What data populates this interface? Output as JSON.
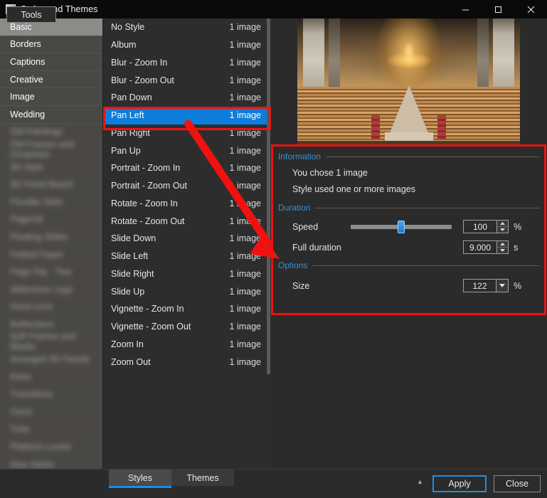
{
  "window": {
    "title": "Styles and Themes",
    "icon": "app-icon",
    "controls": {
      "minimize": "minimize-icon",
      "maximize": "maximize-icon",
      "close": "close-icon"
    }
  },
  "sidebar": {
    "items": [
      {
        "label": "Basic",
        "active": true,
        "blurred": false
      },
      {
        "label": "Borders",
        "active": false,
        "blurred": false
      },
      {
        "label": "Captions",
        "active": false,
        "blurred": false
      },
      {
        "label": "Creative",
        "active": false,
        "blurred": false
      },
      {
        "label": "Image",
        "active": false,
        "blurred": false
      },
      {
        "label": "Wedding",
        "active": false,
        "blurred": false
      },
      {
        "label": "Old Paintings",
        "active": false,
        "blurred": true
      },
      {
        "label": "Old Frames and Ornament",
        "active": false,
        "blurred": true
      },
      {
        "label": "3D Style",
        "active": false,
        "blurred": true
      },
      {
        "label": "3D Panel Board",
        "active": false,
        "blurred": true
      },
      {
        "label": "Flexible Slide",
        "active": false,
        "blurred": true
      },
      {
        "label": "Pageroll",
        "active": false,
        "blurred": true
      },
      {
        "label": "Floating Slides",
        "active": false,
        "blurred": true
      },
      {
        "label": "Folded Paper",
        "active": false,
        "blurred": true
      },
      {
        "label": "Page Flip - Two",
        "active": false,
        "blurred": true
      },
      {
        "label": "Slideshow Logo",
        "active": false,
        "blurred": true
      },
      {
        "label": "Hand Lens",
        "active": false,
        "blurred": true
      },
      {
        "label": "Reflections",
        "active": false,
        "blurred": true
      },
      {
        "label": "Soft Frames and Masks",
        "active": false,
        "blurred": true
      },
      {
        "label": "Arranged 3D Panels",
        "active": false,
        "blurred": true
      },
      {
        "label": "Rotor",
        "active": false,
        "blurred": true
      },
      {
        "label": "Transitions",
        "active": false,
        "blurred": true
      },
      {
        "label": "Clock",
        "active": false,
        "blurred": true
      },
      {
        "label": "Tube",
        "active": false,
        "blurred": true
      },
      {
        "label": "Platform Levels",
        "active": false,
        "blurred": true
      },
      {
        "label": "New Styles",
        "active": false,
        "blurred": true
      }
    ]
  },
  "styles_list": {
    "count_label": "1 image",
    "selected": "Pan Left",
    "items": [
      {
        "name": "No Style",
        "count": "1 image"
      },
      {
        "name": "Album",
        "count": "1 image"
      },
      {
        "name": "Blur - Zoom In",
        "count": "1 image"
      },
      {
        "name": "Blur - Zoom Out",
        "count": "1 image"
      },
      {
        "name": "Pan Down",
        "count": "1 image"
      },
      {
        "name": "Pan Left",
        "count": "1 image"
      },
      {
        "name": "Pan Right",
        "count": "1 image"
      },
      {
        "name": "Pan Up",
        "count": "1 image"
      },
      {
        "name": "Portrait - Zoom In",
        "count": "1 image"
      },
      {
        "name": "Portrait - Zoom Out",
        "count": "1 image"
      },
      {
        "name": "Rotate - Zoom In",
        "count": "1 image"
      },
      {
        "name": "Rotate - Zoom Out",
        "count": "1 image"
      },
      {
        "name": "Slide Down",
        "count": "1 image"
      },
      {
        "name": "Slide Left",
        "count": "1 image"
      },
      {
        "name": "Slide Right",
        "count": "1 image"
      },
      {
        "name": "Slide Up",
        "count": "1 image"
      },
      {
        "name": "Vignette - Zoom In",
        "count": "1 image"
      },
      {
        "name": "Vignette - Zoom Out",
        "count": "1 image"
      },
      {
        "name": "Zoom In",
        "count": "1 image"
      },
      {
        "name": "Zoom Out",
        "count": "1 image"
      }
    ]
  },
  "preview": {
    "alt": "cathedral-interior-preview"
  },
  "panel": {
    "information": {
      "title": "Information",
      "lines": [
        "You chose 1 image",
        "Style used one or more images"
      ]
    },
    "duration": {
      "title": "Duration",
      "speed_label": "Speed",
      "speed_value": "100",
      "speed_unit": "%",
      "speed_slider_percent": 50,
      "full_duration_label": "Full duration",
      "full_duration_value": "9.000",
      "full_duration_unit": "s"
    },
    "options": {
      "title": "Options",
      "size_label": "Size",
      "size_value": "122",
      "size_unit": "%"
    }
  },
  "bottom": {
    "tools_label": "Tools",
    "tabs": [
      {
        "label": "Styles",
        "active": true
      },
      {
        "label": "Themes",
        "active": false
      }
    ],
    "collapse_icon": "chevron-up-icon",
    "apply_label": "Apply",
    "close_label": "Close"
  },
  "annotations": {
    "accent_color": "#f11111",
    "selection_color": "#0d7ddb",
    "section_title_color": "#3c8fd4"
  }
}
